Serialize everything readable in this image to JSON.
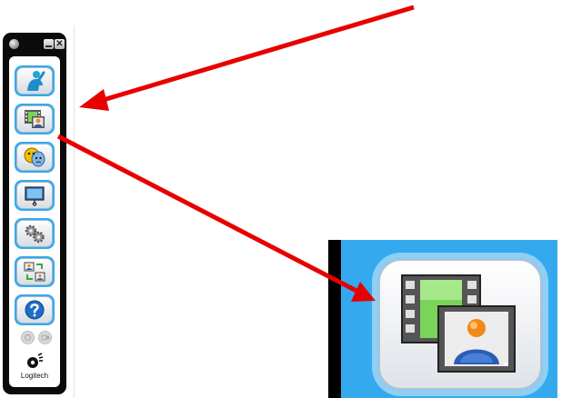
{
  "window": {
    "close_glyph": "✕"
  },
  "toolbar": {
    "buttons": [
      {
        "icon": "person-webcam-icon",
        "active": false
      },
      {
        "icon": "video-effects-icon",
        "active": true
      },
      {
        "icon": "avatar-masks-icon",
        "active": false
      },
      {
        "icon": "presentation-screen-icon",
        "active": false
      },
      {
        "icon": "settings-gears-icon",
        "active": false
      },
      {
        "icon": "swap-photos-icon",
        "active": false
      },
      {
        "icon": "help-question-icon",
        "active": false
      }
    ],
    "mini_buttons": [
      {
        "icon": "snapshot-icon"
      },
      {
        "icon": "record-video-icon"
      }
    ]
  },
  "logo": {
    "text": "Logitech",
    "icon": "logitech-eye-icon"
  },
  "annotations": {
    "arrow_color": "#e80000",
    "accent_blue": "#35a9ee"
  },
  "zoom": {
    "icon": "video-effects-icon"
  }
}
